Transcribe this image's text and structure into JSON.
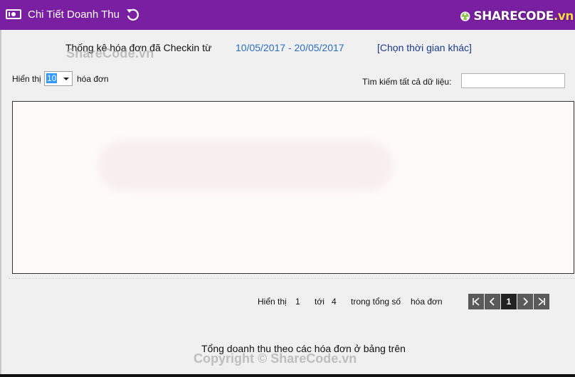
{
  "header": {
    "title": "Chi Tiết Doanh Thu",
    "logo_text_main": "SHARECODE",
    "logo_text_suffix": ".vn"
  },
  "summary": {
    "label": "Thống kê hóa đơn đã Checkin từ",
    "date_range": "10/05/2017 - 20/05/2017",
    "choose_other": "[Chọn thời gian khác]"
  },
  "watermark": {
    "top": "ShareCode.vn",
    "bottom": "Copyright © ShareCode.vn"
  },
  "controls": {
    "show_label": "Hiển thị",
    "page_size": "10",
    "suffix": "hóa đơn",
    "search_label": "Tìm kiếm tất cả dữ liệu:",
    "search_value": ""
  },
  "pager": {
    "show": "Hiển thị",
    "from": "1",
    "to_label": "tới",
    "to": "4",
    "total_label": "trong tổng số",
    "unit": "hóa đơn",
    "current_page": "1"
  },
  "footer": {
    "total_text": "Tổng doanh thu theo các hóa đơn ở bảng trên"
  },
  "colors": {
    "header_bg": "#7b1fa2",
    "link": "#2a6ebb"
  }
}
